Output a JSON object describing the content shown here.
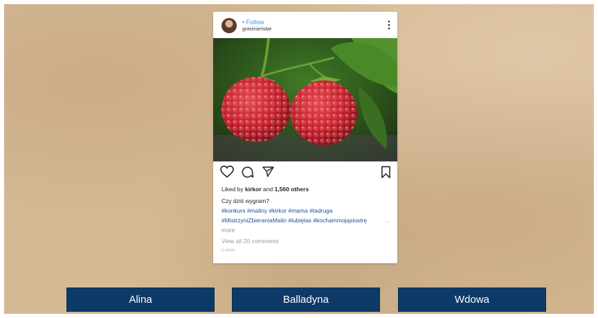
{
  "post": {
    "follow_label": "• Follow",
    "username": "gnieźnieńskie",
    "liked_by_prefix": "Liked by ",
    "liked_by_user": "kirkor",
    "liked_by_and": " and ",
    "liked_by_count": "1,560 others",
    "caption": "Czy dziś wygram?",
    "hashtags_line1": "#konkurs #maliny #kirkor #mama #tadruga",
    "hashtags_line2": "#MistrzyniZbieraniaMalin #lubięlas #kochammojąsiostrę",
    "ellipsis": "...",
    "more_label": "more",
    "view_comments": "View all 20 comments",
    "timestamp": "5 MINS"
  },
  "answers": [
    {
      "label": "Alina"
    },
    {
      "label": "Balladyna"
    },
    {
      "label": "Wdowa"
    }
  ],
  "icons": {
    "like": "heart-icon",
    "comment": "comment-icon",
    "share": "send-icon",
    "save": "bookmark-icon",
    "more": "more-vertical-icon"
  },
  "colors": {
    "background": "#d5b995",
    "button": "#0e3a68",
    "link": "#3897f0",
    "hashtag": "#1f4f95"
  }
}
